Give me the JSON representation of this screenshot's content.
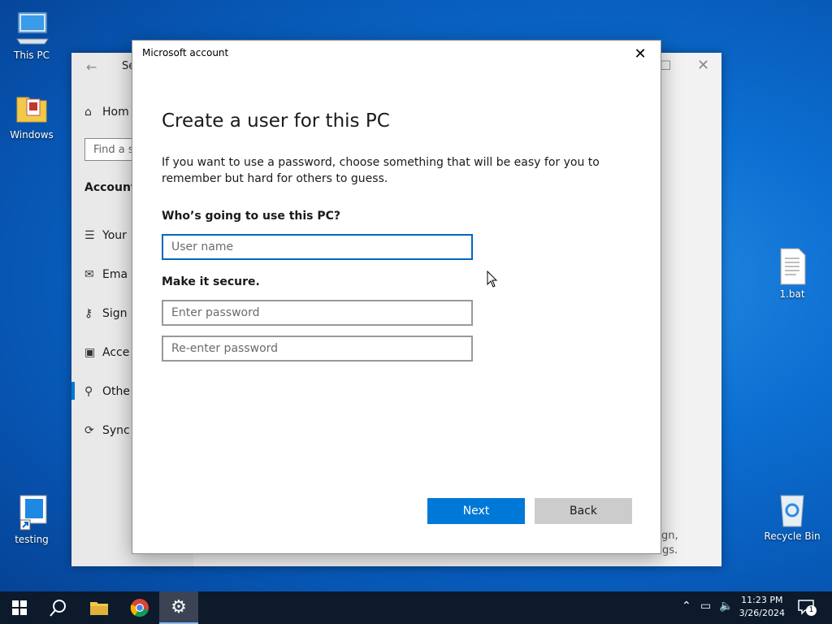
{
  "desktop": {
    "icons": [
      {
        "label": "This PC"
      },
      {
        "label": "Windows"
      },
      {
        "label": "testing"
      },
      {
        "label": "1.bat"
      },
      {
        "label": "Recycle Bin"
      }
    ]
  },
  "settings_window": {
    "title_partial": "Se",
    "search_placeholder_partial": "Find a s",
    "section": "Accounts",
    "items": [
      {
        "label": "Hom",
        "icon": "home-icon"
      },
      {
        "label": "Your",
        "icon": "user-info-icon"
      },
      {
        "label": "Ema",
        "icon": "mail-icon"
      },
      {
        "label": "Sign",
        "icon": "key-icon"
      },
      {
        "label": "Acce",
        "icon": "briefcase-icon"
      },
      {
        "label": "Othe",
        "icon": "person-add-icon"
      },
      {
        "label": "Sync",
        "icon": "sync-icon"
      }
    ],
    "partial_text_1": "gn,",
    "partial_text_2": "gs."
  },
  "dialog": {
    "title": "Microsoft account",
    "heading": "Create a user for this PC",
    "description": "If you want to use a password, choose something that will be easy for you to remember but hard for others to guess.",
    "user_section_label": "Who’s going to use this PC?",
    "username_placeholder": "User name",
    "secure_section_label": "Make it secure.",
    "password_placeholder": "Enter password",
    "reenter_placeholder": "Re-enter password",
    "next_label": "Next",
    "back_label": "Back"
  },
  "taskbar": {
    "time": "11:23 PM",
    "date": "3/26/2024",
    "notification_count": "1"
  },
  "colors": {
    "accent": "#0078d7",
    "focus_border": "#0067c0"
  }
}
